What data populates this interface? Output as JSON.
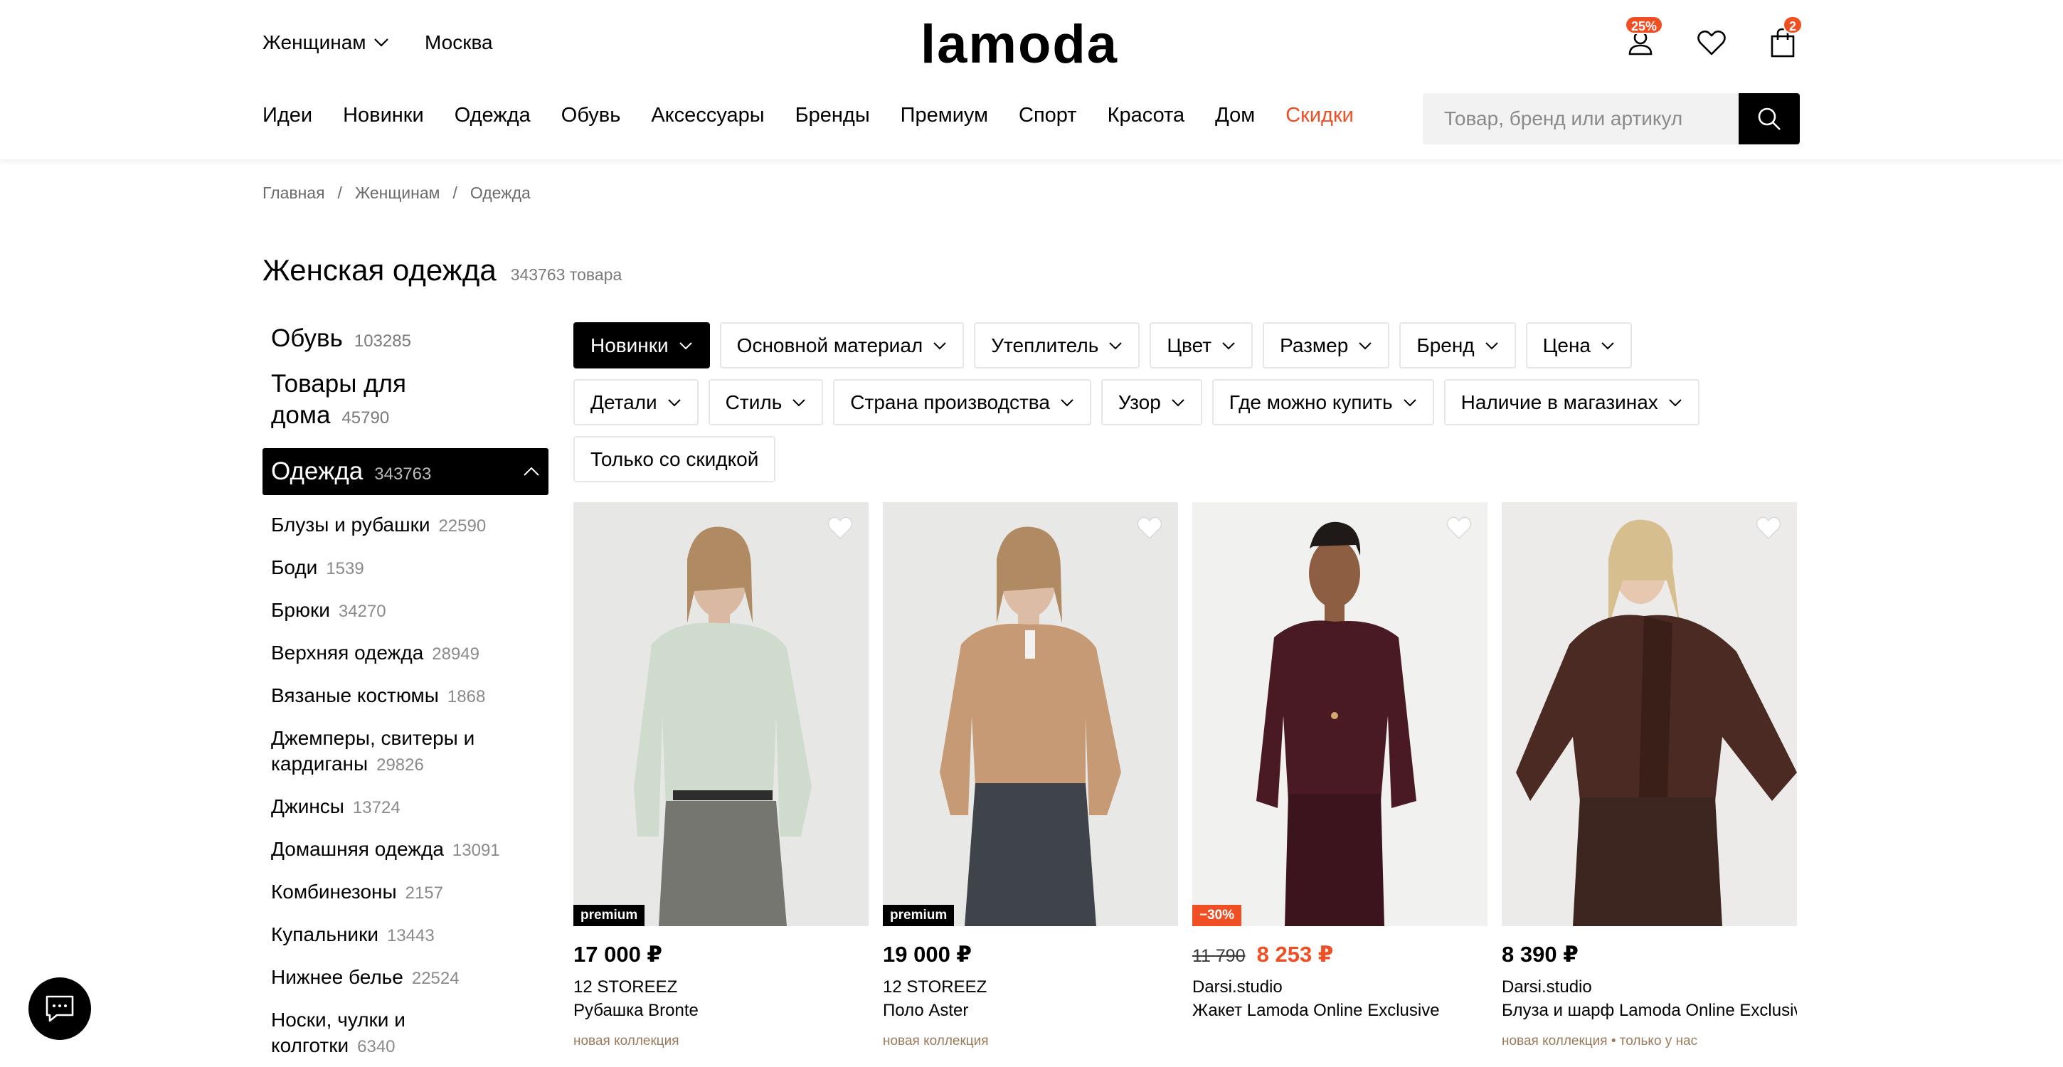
{
  "header": {
    "gender_label": "Женщинам",
    "city": "Москва",
    "logo": "lamoda",
    "profile_badge": "25%",
    "cart_badge": "2",
    "nav": [
      "Идеи",
      "Новинки",
      "Одежда",
      "Обувь",
      "Аксессуары",
      "Бренды",
      "Премиум",
      "Спорт",
      "Красота",
      "Дом",
      "Скидки"
    ],
    "search_placeholder": "Товар, бренд или артикул"
  },
  "breadcrumb": [
    "Главная",
    "Женщинам",
    "Одежда"
  ],
  "page": {
    "title": "Женская одежда",
    "count": "343763 товара"
  },
  "sidebar": {
    "shoes": {
      "label": "Обувь",
      "count": "103285"
    },
    "home": {
      "label": "Товары для дома",
      "count": "45790"
    },
    "clothes": {
      "label": "Одежда",
      "count": "343763"
    },
    "subcategories": [
      {
        "label": "Блузы и рубашки",
        "count": "22590"
      },
      {
        "label": "Боди",
        "count": "1539"
      },
      {
        "label": "Брюки",
        "count": "34270"
      },
      {
        "label": "Верхняя одежда",
        "count": "28949"
      },
      {
        "label": "Вязаные костюмы",
        "count": "1868"
      },
      {
        "label": "Джемперы, свитеры и кардиганы",
        "count": "29826"
      },
      {
        "label": "Джинсы",
        "count": "13724"
      },
      {
        "label": "Домашняя одежда",
        "count": "13091"
      },
      {
        "label": "Комбинезоны",
        "count": "2157"
      },
      {
        "label": "Купальники",
        "count": "13443"
      },
      {
        "label": "Нижнее белье",
        "count": "22524"
      },
      {
        "label": "Носки, чулки и колготки",
        "count": "6340"
      }
    ]
  },
  "filters": {
    "row1": [
      "Новинки",
      "Основной материал",
      "Утеплитель",
      "Цвет",
      "Размер",
      "Бренд",
      "Цена"
    ],
    "row2": [
      "Детали",
      "Стиль",
      "Страна производства",
      "Узор",
      "Где можно купить",
      "Наличие в магазинах"
    ],
    "row3": [
      "Только со скидкой"
    ]
  },
  "products": [
    {
      "tag": "premium",
      "price": "17 000 ₽",
      "brand": "12 STOREEZ",
      "name": "Рубашка Bronte",
      "note": "новая коллекция"
    },
    {
      "tag": "premium",
      "price": "19 000 ₽",
      "brand": "12 STOREEZ",
      "name": "Поло Aster",
      "note": "новая коллекция"
    },
    {
      "tag": "−30%",
      "old_price": "11 790",
      "new_price": "8 253 ₽",
      "brand": "Darsi.studio",
      "name": "Жакет Lamoda Online Exclusive"
    },
    {
      "price": "8 390 ₽",
      "brand": "Darsi.studio",
      "name": "Блуза и шарф Lamoda Online Exclusive",
      "note": "новая коллекция • только у нас"
    }
  ],
  "colors": {
    "accent": "#f04e23",
    "black": "#000000",
    "chip_border": "#e6e6e6",
    "search_bg": "#f2f2f2"
  },
  "icons": {
    "profile": "profile-icon",
    "wishlist": "heart-icon",
    "cart": "bag-icon",
    "search": "search-icon",
    "chat": "chat-icon"
  }
}
